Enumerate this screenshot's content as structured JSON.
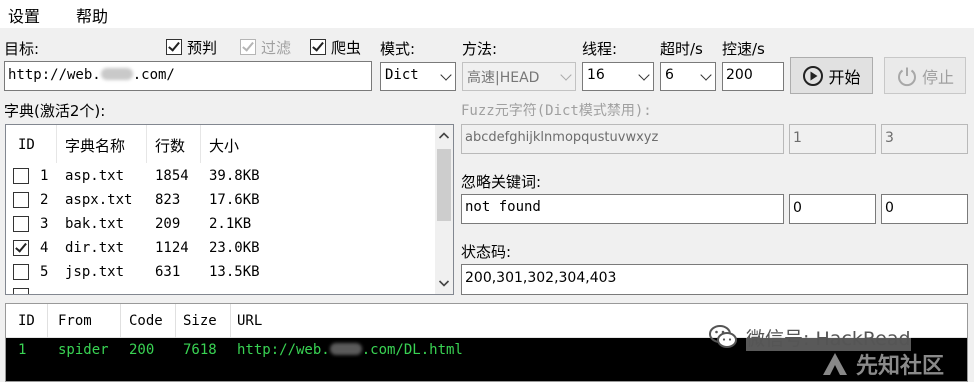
{
  "menu": [
    "设置",
    "帮助"
  ],
  "target": {
    "label": "目标:",
    "url_prefix": "http://web.",
    "url_suffix": ".com/"
  },
  "options": {
    "predict": {
      "label": "预判",
      "checked": true
    },
    "filter": {
      "label": "过滤",
      "checked": true,
      "disabled": true
    },
    "crawler": {
      "label": "爬虫",
      "checked": true
    }
  },
  "mode": {
    "label": "模式:",
    "value": "Dict"
  },
  "method": {
    "label": "方法:",
    "value": "高速|HEAD"
  },
  "threads": {
    "label": "线程:",
    "value": "16"
  },
  "timeout": {
    "label": "超时/s",
    "value": "6"
  },
  "speed": {
    "label": "控速/s",
    "value": "200"
  },
  "buttons": {
    "start": "开始",
    "stop": "停止"
  },
  "dict": {
    "label": "字典(激活2个):",
    "headers": [
      "ID",
      "字典名称",
      "行数",
      "大小"
    ],
    "rows": [
      {
        "id": "1",
        "name": "asp.txt",
        "lines": "1854",
        "size": "39.8KB",
        "checked": false
      },
      {
        "id": "2",
        "name": "aspx.txt",
        "lines": "823",
        "size": "17.6KB",
        "checked": false
      },
      {
        "id": "3",
        "name": "bak.txt",
        "lines": "209",
        "size": "2.1KB",
        "checked": false
      },
      {
        "id": "4",
        "name": "dir.txt",
        "lines": "1124",
        "size": "23.0KB",
        "checked": true
      },
      {
        "id": "5",
        "name": "jsp.txt",
        "lines": "631",
        "size": "13.5KB",
        "checked": false
      }
    ]
  },
  "fuzz": {
    "label": "Fuzz元字符(Dict模式禁用):",
    "charset": "abcdefghijklnmopqustuvwxyz",
    "min": "1",
    "max": "3"
  },
  "ignore": {
    "label": "忽略关键词:",
    "value": "not found",
    "n1": "0",
    "n2": "0"
  },
  "status": {
    "label": "状态码:",
    "value": "200,301,302,304,403"
  },
  "results": {
    "headers": [
      "ID",
      "From",
      "Code",
      "Size",
      "URL"
    ],
    "rows": [
      {
        "id": "1",
        "from": "spider",
        "code": "200",
        "size": "7618",
        "url_prefix": "http://web.",
        "url_suffix": ".com/DL.html"
      }
    ]
  },
  "watermark": {
    "wechat": "微信号: HackRead",
    "site": "先知社区"
  }
}
